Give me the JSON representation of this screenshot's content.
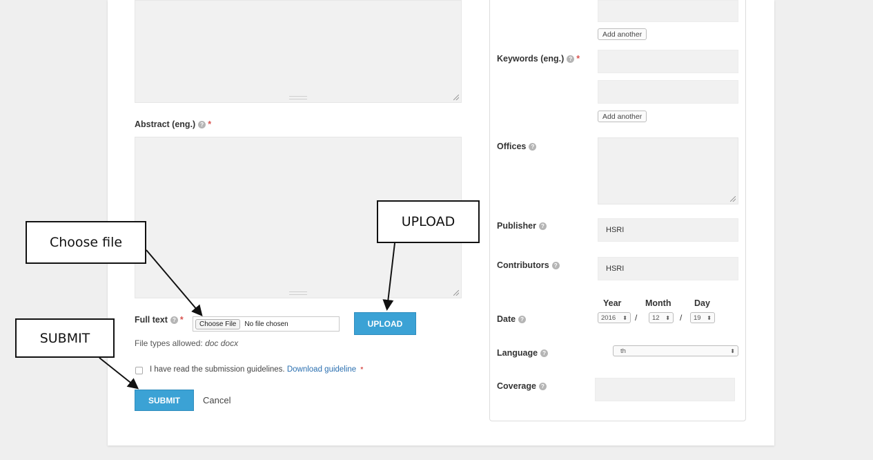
{
  "form": {
    "abstract_label": "Abstract (eng.)",
    "fulltext_label": "Full text",
    "choose_file_label": "Choose File",
    "no_file_text": "No file chosen",
    "upload_label": "UPLOAD",
    "file_types_prefix": "File types allowed:",
    "file_types": "doc docx",
    "guidelines_text": "I have read the submission guidelines.",
    "guideline_link": "Download guideline",
    "submit_label": "SUBMIT",
    "cancel_label": "Cancel",
    "required_mark": "*",
    "help_glyph": "?"
  },
  "sidebar": {
    "add_another_label": "Add another",
    "keywords_label": "Keywords (eng.)",
    "offices_label": "Offices",
    "publisher_label": "Publisher",
    "publisher_value": "HSRI",
    "contributors_label": "Contributors",
    "contributors_value": "HSRI",
    "date_label": "Date",
    "year_header": "Year",
    "month_header": "Month",
    "day_header": "Day",
    "year_value": "2016",
    "month_value": "12",
    "day_value": "19",
    "date_separator": "/",
    "language_label": "Language",
    "language_value": "th",
    "coverage_label": "Coverage",
    "select_arrow": "⬍"
  },
  "callouts": {
    "choose_file": "Choose file",
    "upload": "UPLOAD",
    "submit": "SUBMIT"
  },
  "colors": {
    "accent": "#3ba2d5",
    "required": "#d9534f",
    "link": "#2a6fb0",
    "field_bg": "#f1f1f1"
  }
}
